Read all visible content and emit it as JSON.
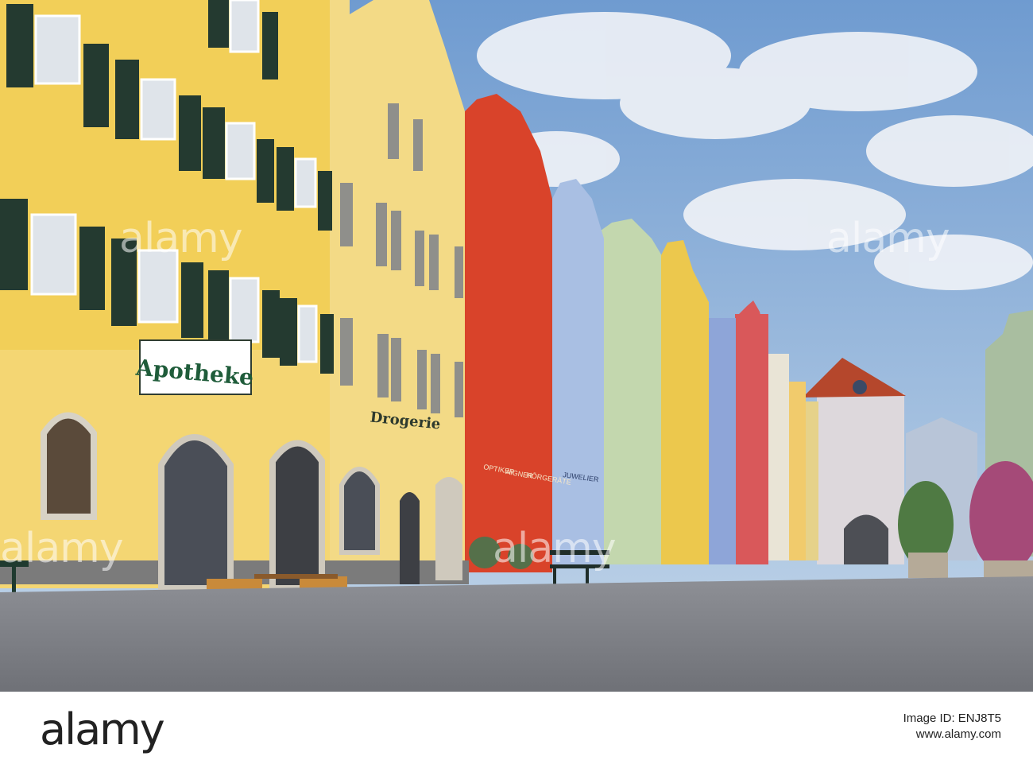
{
  "scene": {
    "signs": {
      "apotheke": "Apotheke",
      "drogerie": "Drogerie",
      "optiker": "OPTIKER",
      "aigner": "AIGNER",
      "hoergeraete": "HÖRGERÄTE",
      "juwelier": "JUWELIER"
    },
    "colors": {
      "sky": "#8fb4d8",
      "yellow_house": "#f2d15c",
      "red_house": "#d9432a",
      "blue_house": "#a9bfe3",
      "green_house": "#c3d7ae",
      "cobblestone": "#8a8c91"
    }
  },
  "watermarks": [
    "alamy",
    "alamy",
    "alamy",
    "alamy"
  ],
  "footer": {
    "logo": "alamy",
    "image_id_label": "Image ID: ENJ8T5",
    "website": "www.alamy.com"
  }
}
